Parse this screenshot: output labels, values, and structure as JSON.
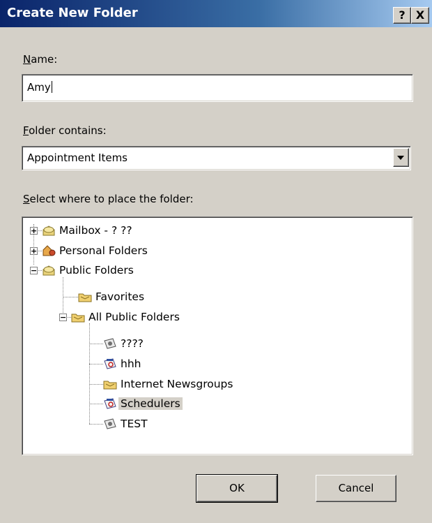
{
  "window": {
    "title": "Create New Folder",
    "help_label": "?",
    "close_label": "X"
  },
  "name_field": {
    "label_accel": "N",
    "label_rest": "ame:",
    "value": "Amy"
  },
  "contains_field": {
    "label_accel": "F",
    "label_rest": "older contains:",
    "value": "Appointment Items"
  },
  "tree_label": {
    "label_accel": "S",
    "label_rest": "elect where to place the folder:"
  },
  "tree": {
    "items": [
      {
        "label": "Mailbox - ? ??",
        "icon": "mailbox-icon"
      },
      {
        "label": "Personal Folders",
        "icon": "personal-folders-icon"
      },
      {
        "label": "Public Folders",
        "icon": "public-folders-icon"
      },
      {
        "label": "Favorites",
        "icon": "folder-icon"
      },
      {
        "label": "All Public Folders",
        "icon": "folder-icon"
      },
      {
        "label": "????",
        "icon": "contacts-folder-icon"
      },
      {
        "label": "hhh",
        "icon": "calendar-folder-icon"
      },
      {
        "label": "Internet Newsgroups",
        "icon": "folder-icon"
      },
      {
        "label": "Schedulers",
        "icon": "calendar-folder-icon",
        "selected": true
      },
      {
        "label": "TEST",
        "icon": "contacts-folder-icon"
      }
    ]
  },
  "buttons": {
    "ok": "OK",
    "cancel": "Cancel"
  }
}
